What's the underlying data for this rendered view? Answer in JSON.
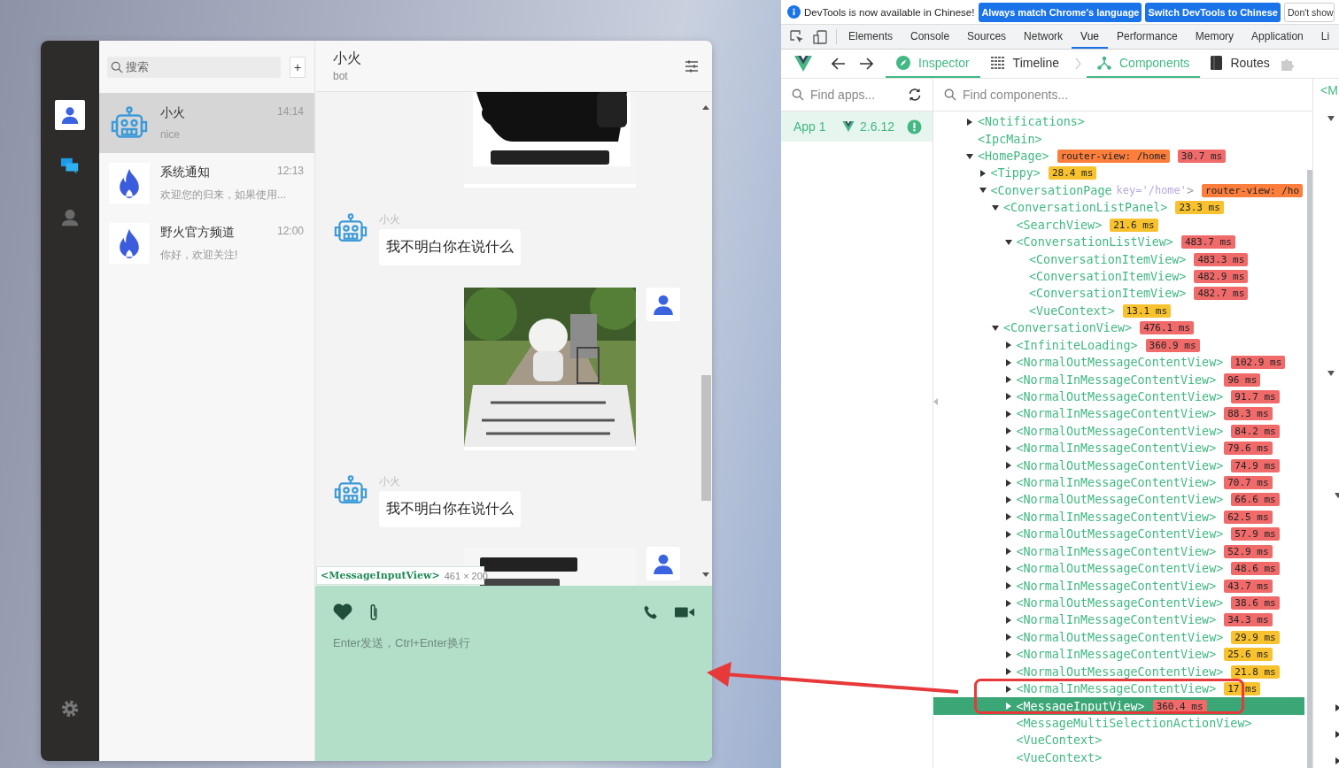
{
  "chat_app": {
    "sidebar": {
      "items": [
        {
          "kind": "contacts",
          "selected": true
        },
        {
          "kind": "conversations",
          "selected": false
        },
        {
          "kind": "profile",
          "selected": false
        }
      ]
    },
    "search": {
      "placeholder": "搜索",
      "add_button": "+"
    },
    "conversations": [
      {
        "kind": "robot",
        "name": "小火",
        "time": "14:14",
        "preview": "nice",
        "selected": true
      },
      {
        "kind": "flame",
        "name": "系统通知",
        "time": "12:13",
        "preview": "欢迎您的归来，如果使用...",
        "selected": false
      },
      {
        "kind": "flame",
        "name": "野火官方频道",
        "time": "12:00",
        "preview": "你好，欢迎关注!",
        "selected": false
      }
    ],
    "chat": {
      "title": "小火",
      "subtitle": "bot",
      "messages": [
        {
          "kind": "picture",
          "cut_top": true
        },
        {
          "kind": "text",
          "sender": "小火",
          "text": "我不明白你在说什么"
        },
        {
          "kind": "picture",
          "cut_top": false
        },
        {
          "kind": "text",
          "sender": "小火",
          "text": "我不明白你在说什么"
        },
        {
          "kind": "picture",
          "cut_top": false
        }
      ],
      "tooltip": {
        "component": "<MessageInputView>",
        "size": "461 × 200"
      },
      "input": {
        "placeholder": "Enter发送，Ctrl+Enter换行"
      }
    }
  },
  "devtools": {
    "infobar": {
      "message": "DevTools is now available in Chinese!",
      "buttons": [
        {
          "label": "Always match Chrome's language",
          "kind": "primary"
        },
        {
          "label": "Switch DevTools to Chinese",
          "kind": "primary"
        },
        {
          "label": "Don't show",
          "kind": "secondary"
        }
      ]
    },
    "tabs": [
      {
        "label": "Elements",
        "selected": false
      },
      {
        "label": "Console",
        "selected": false
      },
      {
        "label": "Sources",
        "selected": false
      },
      {
        "label": "Network",
        "selected": false
      },
      {
        "label": "Vue",
        "selected": true
      },
      {
        "label": "Performance",
        "selected": false
      },
      {
        "label": "Memory",
        "selected": false
      },
      {
        "label": "Application",
        "selected": false
      },
      {
        "label": "Li",
        "selected": false
      }
    ],
    "vue_tabs": [
      {
        "label": "Inspector",
        "selected": true
      },
      {
        "label": "Timeline",
        "selected": false
      }
    ],
    "inspector_tabs": [
      {
        "label": "Components",
        "selected": true
      },
      {
        "label": "Routes",
        "selected": false
      }
    ],
    "apps_search": {
      "placeholder": "Find apps..."
    },
    "apps": [
      {
        "name": "App 1",
        "version": "2.6.12",
        "selected": true
      }
    ],
    "components_search": {
      "placeholder": "Find components..."
    },
    "tree": [
      {
        "label": "<Notifications>",
        "expanded": false,
        "selected": false
      },
      {
        "label": "<IpcMain>",
        "selected": false
      },
      {
        "label": "<HomePage>",
        "expanded": true,
        "selected": false,
        "tags": [
          {
            "text": "router-view: /home",
            "color": "#fb7e3c"
          },
          {
            "text": "30.7 ms",
            "color": "#f06a6a"
          }
        ],
        "children": [
          {
            "label": "<Tippy>",
            "expanded": false,
            "selected": false,
            "tags": [
              {
                "text": "28.4 ms",
                "color": "#f8c22e"
              }
            ]
          },
          {
            "label": "<ConversationPage",
            "attr": "key='/home'",
            "label_end": ">",
            "expanded": true,
            "selected": false,
            "tags": [
              {
                "text": "router-view: /ho",
                "color": "#fb7e3c"
              }
            ],
            "children": [
              {
                "label": "<ConversationListPanel>",
                "expanded": true,
                "selected": false,
                "tags": [
                  {
                    "text": "23.3 ms",
                    "color": "#f8c22e"
                  }
                ],
                "children": [
                  {
                    "label": "<SearchView>",
                    "selected": false,
                    "tags": [
                      {
                        "text": "21.6 ms",
                        "color": "#f8c22e"
                      }
                    ]
                  },
                  {
                    "label": "<ConversationListView>",
                    "expanded": true,
                    "selected": false,
                    "tags": [
                      {
                        "text": "483.7 ms",
                        "color": "#f06a6a"
                      }
                    ],
                    "children": [
                      {
                        "label": "<ConversationItemView>",
                        "selected": false,
                        "tags": [
                          {
                            "text": "483.3 ms",
                            "color": "#f06a6a"
                          }
                        ]
                      },
                      {
                        "label": "<ConversationItemView>",
                        "selected": false,
                        "tags": [
                          {
                            "text": "482.9 ms",
                            "color": "#f06a6a"
                          }
                        ]
                      },
                      {
                        "label": "<ConversationItemView>",
                        "selected": false,
                        "tags": [
                          {
                            "text": "482.7 ms",
                            "color": "#f06a6a"
                          }
                        ]
                      },
                      {
                        "label": "<VueContext>",
                        "selected": false,
                        "tags": [
                          {
                            "text": "13.1 ms",
                            "color": "#f8c22e"
                          }
                        ]
                      }
                    ]
                  }
                ]
              },
              {
                "label": "<ConversationView>",
                "expanded": true,
                "selected": false,
                "tags": [
                  {
                    "text": "476.1 ms",
                    "color": "#f06a6a"
                  }
                ],
                "children": [
                  {
                    "label": "<InfiniteLoading>",
                    "expanded": false,
                    "selected": false,
                    "tags": [
                      {
                        "text": "360.9 ms",
                        "color": "#f06a6a"
                      }
                    ]
                  },
                  {
                    "label": "<NormalOutMessageContentView>",
                    "expanded": false,
                    "selected": false,
                    "tags": [
                      {
                        "text": "102.9 ms",
                        "color": "#f06a6a"
                      }
                    ]
                  },
                  {
                    "label": "<NormalInMessageContentView>",
                    "expanded": false,
                    "selected": false,
                    "tags": [
                      {
                        "text": "96 ms",
                        "color": "#f06a6a"
                      }
                    ]
                  },
                  {
                    "label": "<NormalOutMessageContentView>",
                    "expanded": false,
                    "selected": false,
                    "tags": [
                      {
                        "text": "91.7 ms",
                        "color": "#f06a6a"
                      }
                    ]
                  },
                  {
                    "label": "<NormalInMessageContentView>",
                    "expanded": false,
                    "selected": false,
                    "tags": [
                      {
                        "text": "88.3 ms",
                        "color": "#f06a6a"
                      }
                    ]
                  },
                  {
                    "label": "<NormalOutMessageContentView>",
                    "expanded": false,
                    "selected": false,
                    "tags": [
                      {
                        "text": "84.2 ms",
                        "color": "#f06a6a"
                      }
                    ]
                  },
                  {
                    "label": "<NormalInMessageContentView>",
                    "expanded": false,
                    "selected": false,
                    "tags": [
                      {
                        "text": "79.6 ms",
                        "color": "#f06a6a"
                      }
                    ]
                  },
                  {
                    "label": "<NormalOutMessageContentView>",
                    "expanded": false,
                    "selected": false,
                    "tags": [
                      {
                        "text": "74.9 ms",
                        "color": "#f06a6a"
                      }
                    ]
                  },
                  {
                    "label": "<NormalInMessageContentView>",
                    "expanded": false,
                    "selected": false,
                    "tags": [
                      {
                        "text": "70.7 ms",
                        "color": "#f06a6a"
                      }
                    ]
                  },
                  {
                    "label": "<NormalOutMessageContentView>",
                    "expanded": false,
                    "selected": false,
                    "tags": [
                      {
                        "text": "66.6 ms",
                        "color": "#f06a6a"
                      }
                    ]
                  },
                  {
                    "label": "<NormalInMessageContentView>",
                    "expanded": false,
                    "selected": false,
                    "tags": [
                      {
                        "text": "62.5 ms",
                        "color": "#f06a6a"
                      }
                    ]
                  },
                  {
                    "label": "<NormalOutMessageContentView>",
                    "expanded": false,
                    "selected": false,
                    "tags": [
                      {
                        "text": "57.9 ms",
                        "color": "#f06a6a"
                      }
                    ]
                  },
                  {
                    "label": "<NormalInMessageContentView>",
                    "expanded": false,
                    "selected": false,
                    "tags": [
                      {
                        "text": "52.9 ms",
                        "color": "#f06a6a"
                      }
                    ]
                  },
                  {
                    "label": "<NormalOutMessageContentView>",
                    "expanded": false,
                    "selected": false,
                    "tags": [
                      {
                        "text": "48.6 ms",
                        "color": "#f06a6a"
                      }
                    ]
                  },
                  {
                    "label": "<NormalInMessageContentView>",
                    "expanded": false,
                    "selected": false,
                    "tags": [
                      {
                        "text": "43.7 ms",
                        "color": "#f06a6a"
                      }
                    ]
                  },
                  {
                    "label": "<NormalOutMessageContentView>",
                    "expanded": false,
                    "selected": false,
                    "tags": [
                      {
                        "text": "38.6 ms",
                        "color": "#f06a6a"
                      }
                    ]
                  },
                  {
                    "label": "<NormalInMessageContentView>",
                    "expanded": false,
                    "selected": false,
                    "tags": [
                      {
                        "text": "34.3 ms",
                        "color": "#f06a6a"
                      }
                    ]
                  },
                  {
                    "label": "<NormalOutMessageContentView>",
                    "expanded": false,
                    "selected": false,
                    "tags": [
                      {
                        "text": "29.9 ms",
                        "color": "#f8c22e"
                      }
                    ]
                  },
                  {
                    "label": "<NormalInMessageContentView>",
                    "expanded": false,
                    "selected": false,
                    "tags": [
                      {
                        "text": "25.6 ms",
                        "color": "#f8c22e"
                      }
                    ]
                  },
                  {
                    "label": "<NormalOutMessageContentView>",
                    "expanded": false,
                    "selected": false,
                    "tags": [
                      {
                        "text": "21.8 ms",
                        "color": "#f8c22e"
                      }
                    ]
                  },
                  {
                    "label": "<NormalInMessageContentView>",
                    "expanded": false,
                    "selected": false,
                    "tags": [
                      {
                        "text": "17 ms",
                        "color": "#f8c22e"
                      }
                    ]
                  },
                  {
                    "label": "<MessageInputView>",
                    "expanded": false,
                    "selected": true,
                    "tags": [
                      {
                        "text": "360.4 ms",
                        "color": "#f06a6a"
                      }
                    ]
                  },
                  {
                    "label": "<MessageMultiSelectionActionView>",
                    "selected": false
                  },
                  {
                    "label": "<VueContext>",
                    "selected": false
                  },
                  {
                    "label": "<VueContext>",
                    "selected": false
                  }
                ]
              }
            ]
          }
        ]
      }
    ],
    "side_panel": {
      "text": "<M"
    }
  }
}
